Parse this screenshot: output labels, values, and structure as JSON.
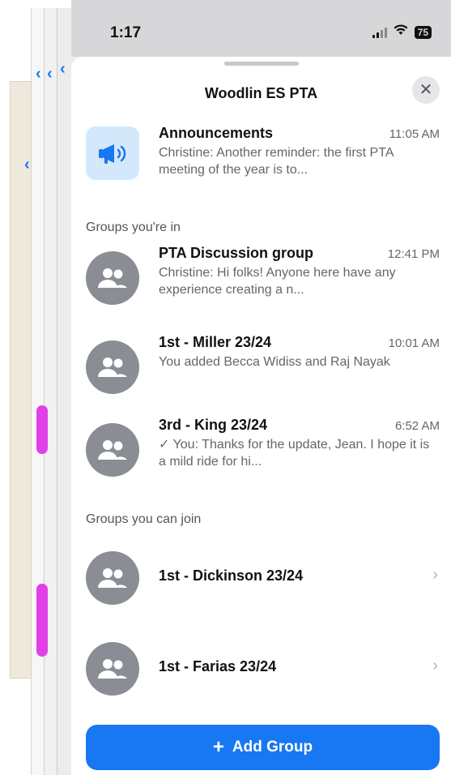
{
  "status_bar": {
    "time": "1:17",
    "battery": "75"
  },
  "sheet": {
    "title": "Woodlin ES PTA",
    "close_glyph": "✕"
  },
  "announcements": {
    "name": "Announcements",
    "time": "11:05 AM",
    "preview": "Christine: Another reminder: the first PTA meeting of the year is to...",
    "icon": "megaphone-icon"
  },
  "groups_in": {
    "label": "Groups you're in",
    "items": [
      {
        "name": "PTA Discussion group",
        "time": "12:41 PM",
        "preview": "Christine: Hi folks!  Anyone here have any experience creating a n..."
      },
      {
        "name": "1st - Miller 23/24",
        "time": "10:01 AM",
        "preview": "You added Becca Widiss and Raj Nayak"
      },
      {
        "name": "3rd - King 23/24",
        "time": "6:52 AM",
        "preview": "✓ You: Thanks for the update, Jean. I hope it is a mild ride for hi..."
      }
    ]
  },
  "groups_join": {
    "label": "Groups you can join",
    "items": [
      {
        "name": "1st - Dickinson 23/24"
      },
      {
        "name": "1st - Farias 23/24"
      }
    ]
  },
  "add_group": {
    "plus": "+",
    "label": "Add Group"
  },
  "colors": {
    "accent": "#1877f2",
    "avatar": "#8a8d94",
    "announce_bg": "#d4e8fb"
  }
}
